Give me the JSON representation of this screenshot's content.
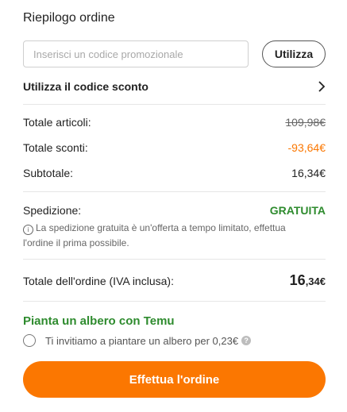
{
  "summary": {
    "title": "Riepilogo ordine",
    "promo_placeholder": "Inserisci un codice promozionale",
    "promo_value": "",
    "apply_label": "Utilizza",
    "discount_link_label": "Utilizza il codice sconto"
  },
  "totals": {
    "items_label": "Totale articoli:",
    "items_value": "109,98€",
    "discounts_label": "Totale sconti:",
    "discounts_value": "-93,64€",
    "subtotal_label": "Subtotale:",
    "subtotal_value": "16,34€"
  },
  "shipping": {
    "label": "Spedizione:",
    "value": "GRATUITA",
    "note": "La spedizione gratuita è un'offerta a tempo limitato, effettua l'ordine il prima possibile."
  },
  "order_total": {
    "label": "Totale dell'ordine (IVA inclusa):",
    "integer": "16",
    "decimal": ",34€"
  },
  "tree": {
    "title": "Pianta un albero con Temu",
    "text": "Ti invitiamo a piantare un albero per 0,23€",
    "help_icon": "question-icon"
  },
  "checkout": {
    "button_label": "Effettua l'ordine"
  },
  "colors": {
    "accent_orange": "#fb7701",
    "green": "#2e8b2e"
  }
}
